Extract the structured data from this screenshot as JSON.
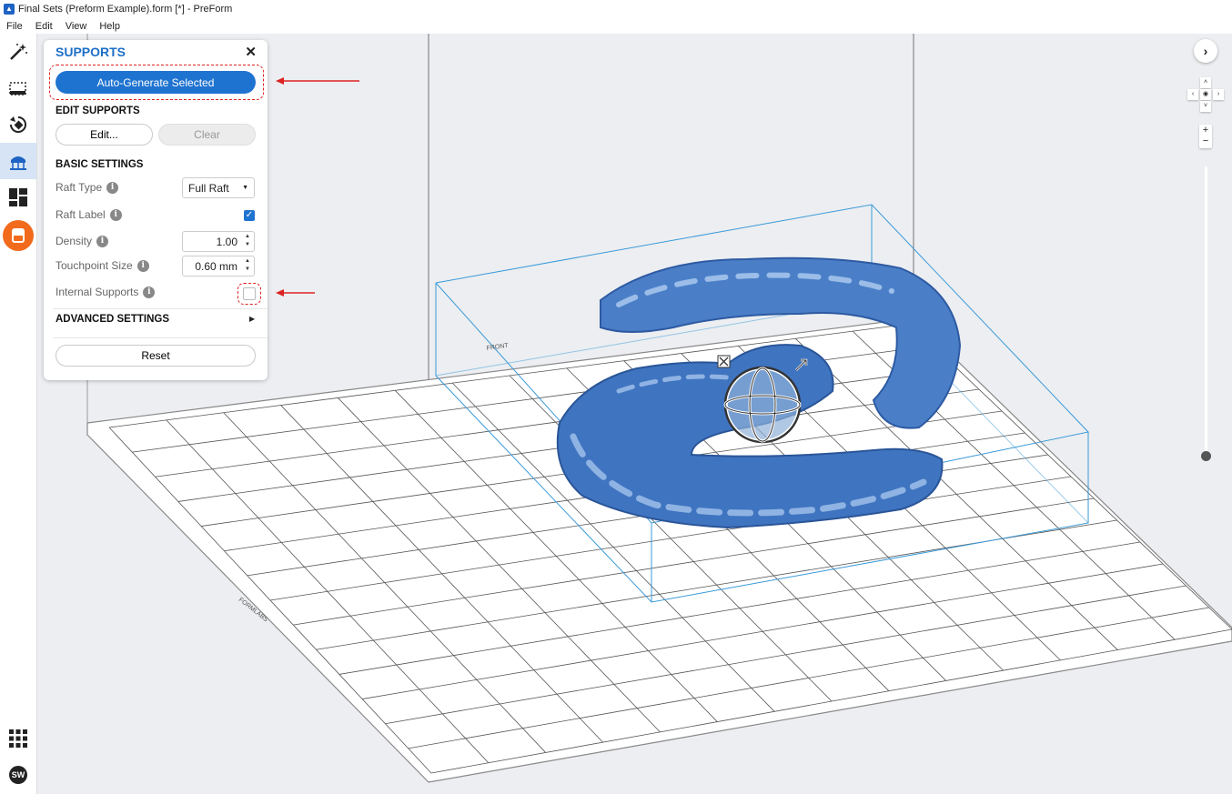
{
  "window": {
    "title": "Final Sets (Preform Example).form [*] - PreForm"
  },
  "menu": [
    "File",
    "Edit",
    "View",
    "Help"
  ],
  "toolbar": {
    "tools": [
      {
        "name": "magic-wand-icon",
        "active": false
      },
      {
        "name": "selection-icon",
        "active": false
      },
      {
        "name": "orientation-icon",
        "active": false
      },
      {
        "name": "supports-icon",
        "active": true
      },
      {
        "name": "layout-icon",
        "active": false
      },
      {
        "name": "printer-status-icon",
        "active": false
      }
    ],
    "bottom": {
      "apps_icon": "grid-icon",
      "user_initials": "SW"
    }
  },
  "panel": {
    "title": "SUPPORTS",
    "auto_generate_label": "Auto-Generate Selected",
    "edit_supports": {
      "heading": "EDIT SUPPORTS",
      "edit_label": "Edit...",
      "clear_label": "Clear"
    },
    "basic": {
      "heading": "BASIC SETTINGS",
      "raft_type": {
        "label": "Raft Type",
        "value": "Full Raft"
      },
      "raft_label": {
        "label": "Raft Label",
        "checked": true
      },
      "density": {
        "label": "Density",
        "value": "1.00"
      },
      "touchpoint": {
        "label": "Touchpoint Size",
        "value": "0.60 mm"
      },
      "internal_supports": {
        "label": "Internal Supports",
        "checked": false
      }
    },
    "advanced_heading": "ADVANCED SETTINGS",
    "reset_label": "Reset"
  },
  "colors": {
    "accent": "#1f73d0",
    "title_blue": "#1e6fc7",
    "annotation_red": "#d22222",
    "model_blue": "#4a7fc8",
    "bounding_box": "#3a9ad9"
  }
}
